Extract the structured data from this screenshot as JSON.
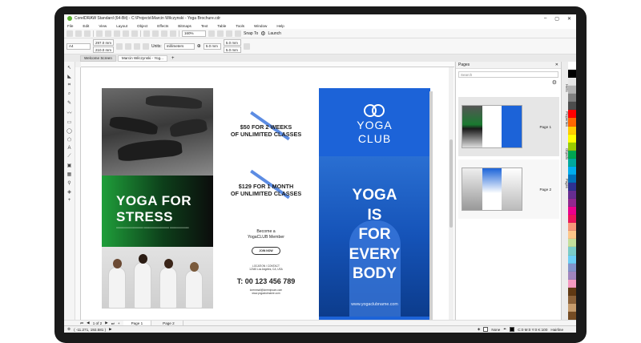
{
  "window": {
    "title": "CorelDRAW Standard (64-Bit) - C:\\Projects\\Marcin Wilczynski - Yoga Brochure.cdr",
    "controls": [
      "–",
      "▢",
      "✕"
    ]
  },
  "menu": [
    "File",
    "Edit",
    "View",
    "Layout",
    "Object",
    "Effects",
    "Bitmaps",
    "Text",
    "Table",
    "Tools",
    "Window",
    "Help"
  ],
  "toolbar": {
    "zoom": "160%",
    "snap_to": "Snap To",
    "launch": "Launch"
  },
  "property_bar": {
    "page_size": "A4",
    "width": "297.0 mm",
    "height": "210.0 mm",
    "units_label": "Units:",
    "units": "millimeters",
    "nudge": "5.0 mm",
    "dup_x": "5.0 mm",
    "dup_y": "5.0 mm"
  },
  "doc_tabs": [
    "Welcome Screen",
    "Marcin Wilczynski - Yog..."
  ],
  "brochure": {
    "panel1": {
      "headline": [
        "YOGA FOR",
        "STRESS"
      ]
    },
    "panel2": {
      "offer1": [
        "$50 FOR 2 WEEKS",
        "OF UNLIMITED CLASSES"
      ],
      "offer2": [
        "$129 FOR 1 MONTH",
        "OF UNLIMITED CLASSES"
      ],
      "member": [
        "Become a",
        "YogaCLUB Member"
      ],
      "join": "JOIN NOW",
      "location": [
        "LOCATION / CONTACT",
        "12345 Los Angeles, CA, USA"
      ],
      "phone": "T: 00 123 456 789",
      "emails": [
        "loremmail@loremipsum.com",
        "www.yogaclubname.com"
      ]
    },
    "panel3": {
      "logo_line1": "YOGA",
      "logo_line2": "CLUB",
      "big": [
        "YOGA",
        "IS",
        "FOR",
        "EVERY",
        "BODY"
      ],
      "url": "www.yogaclubname.com"
    }
  },
  "pages_panel": {
    "title": "Pages",
    "search_placeholder": "Search",
    "pages": [
      {
        "label": "Page 1"
      },
      {
        "label": "Page 2"
      }
    ]
  },
  "dockers": [
    "Hints",
    "Properties",
    "Objects",
    "Pages"
  ],
  "page_tabs": {
    "counter": "1 of 2",
    "tabs": [
      "Page 1",
      "Page 2"
    ]
  },
  "status": {
    "coords": "( -11.271, 192.581 )",
    "fill": "None",
    "outline_color": "C:0 M:0 Y:0 K:100",
    "outline_width": "Hairline"
  },
  "colors": {
    "accent_blue": "#1c63d8",
    "green": "#1f9e3a",
    "slash_blue": "#4a7fe0"
  },
  "palette": [
    "#ffffff",
    "#000000",
    "#e6e6e6",
    "#b3b3b3",
    "#808080",
    "#4d4d4d",
    "#ff0000",
    "#ff6600",
    "#ffcc00",
    "#ffff00",
    "#99cc00",
    "#00a651",
    "#00a99d",
    "#00aeef",
    "#0072bc",
    "#2e3192",
    "#662d91",
    "#92278f",
    "#ec008c",
    "#ed145b",
    "#f7977a",
    "#fdc689",
    "#c4df9b",
    "#7accc8",
    "#6dcff6",
    "#8393ca",
    "#a186be",
    "#f49ac1",
    "#603913",
    "#8c6239",
    "#c69c6d",
    "#754c24"
  ]
}
